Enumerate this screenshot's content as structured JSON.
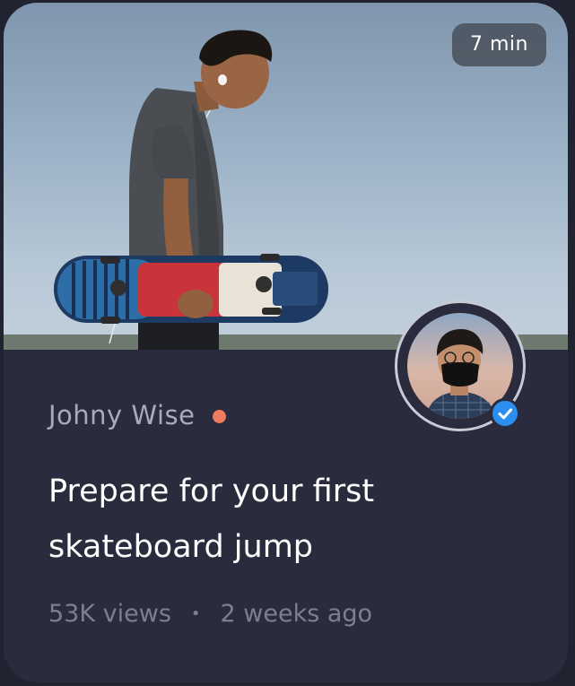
{
  "card": {
    "duration": "7 min",
    "author": {
      "name": "Johny Wise",
      "verified": true,
      "online": true,
      "status_color": "#f07b5c",
      "badge_color": "#2b8ff0"
    },
    "title": "Prepare for your first skateboard jump",
    "stats": {
      "views": "53K views",
      "separator": "•",
      "posted": "2 weeks ago"
    },
    "colors": {
      "background": "#222331",
      "card": "#2a2c3d",
      "title": "#ffffff",
      "muted": "#7c7f92"
    }
  }
}
